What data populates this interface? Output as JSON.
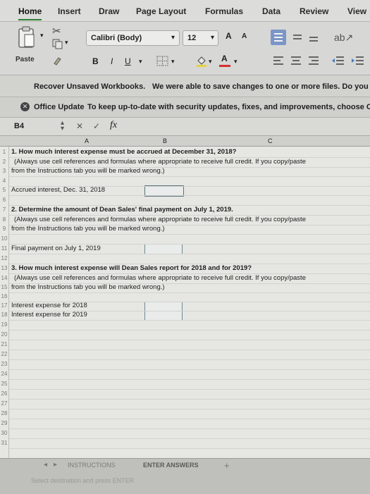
{
  "ribbon": {
    "tabs": [
      "Home",
      "Insert",
      "Draw",
      "Page Layout",
      "Formulas",
      "Data",
      "Review",
      "View"
    ],
    "active_tab": "Home",
    "paste_label": "Paste",
    "font_name": "Calibri (Body)",
    "font_size": "12",
    "grow_font": "A",
    "shrink_font": "A",
    "bold": "B",
    "italic": "I",
    "underline": "U",
    "font_color_glyph": "A"
  },
  "recover_bar": {
    "title": "Recover Unsaved Workbooks.",
    "message": "We were able to save changes to one or more files. Do you w"
  },
  "update_bar": {
    "title": "Office Update",
    "message": "To keep up-to-date with security updates, fixes, and improvements, choose Ch"
  },
  "formula_bar": {
    "cell_ref": "B4",
    "cancel": "✕",
    "enter": "✓",
    "fx": "fx"
  },
  "columns": [
    "A",
    "B",
    "C"
  ],
  "rows": [
    "1",
    "2",
    "3",
    "4",
    "5",
    "6",
    "7",
    "8",
    "9",
    "10",
    "11",
    "12",
    "13",
    "14",
    "15",
    "16",
    "17",
    "18",
    "19",
    "20",
    "21",
    "22",
    "23",
    "24",
    "25",
    "26",
    "27",
    "28",
    "29",
    "30",
    "31"
  ],
  "content": {
    "q1_title": "1. How much interest expense must be accrued at December 31, 2018?",
    "q1_note_1": "(Always use cell references and formulas where appropriate to receive full credit. If you copy/paste",
    "q1_note_2": "from the Instructions tab you will be marked wrong.)",
    "q1_label": "Accrued interest, Dec. 31, 2018",
    "q2_title": "2. Determine the amount of Dean Sales' final payment on July 1, 2019.",
    "q2_note_1": "(Always use cell references and formulas where appropriate to receive full credit. If you copy/paste",
    "q2_note_2": "from the Instructions tab you will be marked wrong.)",
    "q2_label": "Final payment on July 1, 2019",
    "q3_title": "3. How much interest expense will Dean Sales report for 2018 and for 2019?",
    "q3_note_1": "(Always use cell references and formulas where appropriate to receive full credit. If you copy/paste",
    "q3_note_2": "from the Instructions tab you will be marked wrong.)",
    "q3_label_1": "Interest expense for 2018",
    "q3_label_2": "Interest expense for 2019"
  },
  "sheet_tabs": {
    "tab_1": "INSTRUCTIONS",
    "tab_2": "ENTER ANSWERS",
    "add": "+",
    "status": "Select destination and press ENTER"
  }
}
